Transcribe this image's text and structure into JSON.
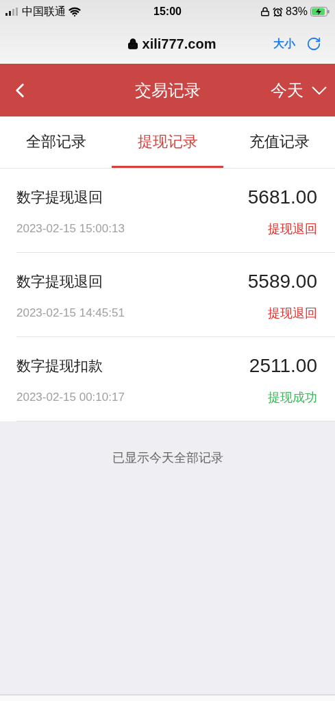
{
  "status_bar": {
    "carrier": "中国联通",
    "time": "15:00",
    "battery": "83%"
  },
  "browser": {
    "url": "xili777.com",
    "text_size": "大小"
  },
  "header": {
    "title": "交易记录",
    "filter": "今天"
  },
  "tabs": [
    {
      "label": "全部记录",
      "selected": false
    },
    {
      "label": "提现记录",
      "selected": true
    },
    {
      "label": "充值记录",
      "selected": false
    }
  ],
  "records": [
    {
      "title": "数字提现退回",
      "time": "2023-02-15 15:00:13",
      "amount": "5681.00",
      "status": "提现退回",
      "color": "#e0302c"
    },
    {
      "title": "数字提现退回",
      "time": "2023-02-15 14:45:51",
      "amount": "5589.00",
      "status": "提现退回",
      "color": "#e0302c"
    },
    {
      "title": "数字提现扣款",
      "time": "2023-02-15 00:10:17",
      "amount": "2511.00",
      "status": "提现成功",
      "color": "#3cb55a"
    }
  ],
  "footer_note": "已显示今天全部记录"
}
